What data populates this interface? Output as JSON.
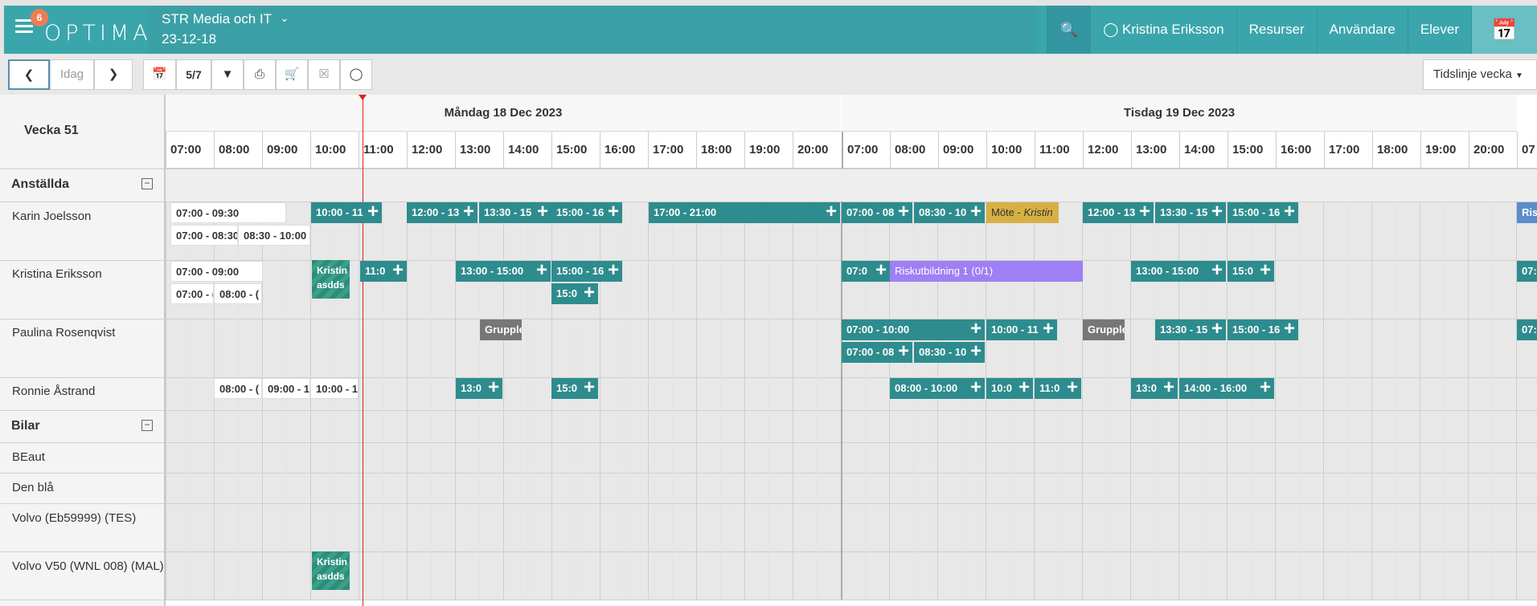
{
  "header": {
    "notifications": "6",
    "logo": "OPTIMA",
    "org_name": "STR Media och IT",
    "date": "23-12-18",
    "user": "Kristina Eriksson",
    "nav": [
      "Resurser",
      "Användare",
      "Elever"
    ]
  },
  "toolbar": {
    "today": "Idag",
    "days_count": "5/7",
    "view_select": "Tidslinje vecka"
  },
  "calendar": {
    "week": "Vecka 51",
    "days": [
      "Måndag 18 Dec 2023",
      "Tisdag 19 Dec 2023"
    ],
    "hours_day1": [
      "07:00",
      "08:00",
      "09:00",
      "10:00",
      "11:00",
      "12:00",
      "13:00",
      "14:00",
      "15:00",
      "16:00",
      "17:00",
      "18:00",
      "19:00",
      "20:00"
    ],
    "hours_day2": [
      "07:00",
      "08:00",
      "09:00",
      "10:00",
      "11:00",
      "12:00",
      "13:00",
      "14:00",
      "15:00",
      "16:00",
      "17:00",
      "18:00",
      "19:00",
      "20:00",
      "07"
    ],
    "sections": [
      "Anställda",
      "Bilar"
    ],
    "employees": [
      "Karin Joelsson",
      "Kristina Eriksson",
      "Paulina Rosenqvist",
      "Ronnie Åstrand"
    ],
    "cars": [
      "BEaut",
      "Den blå",
      "Volvo (Eb59999) (TES)",
      "Volvo V50 (WNL 008) (MAL)"
    ]
  },
  "events": {
    "karin": [
      "07:00 - 09:30",
      "07:00 - 08:30",
      "08:30 - 10:00",
      "10:00 - 11",
      "12:00 - 13",
      "13:30 - 15",
      "15:00 - 16",
      "17:00 - 21:00",
      "07:00 - 08",
      "08:30 - 10",
      "Möte -",
      "Kristin",
      "12:00 - 13",
      "13:30 - 15",
      "15:00 - 16",
      "Ris"
    ],
    "kristina": [
      "07:00 - 09:00",
      "07:00 - (",
      "08:00 - (",
      "Kristin",
      "asdds",
      "11:0",
      "13:00 - 15:00",
      "15:00 - 16",
      "15:0",
      "07:0",
      "Riskutbildning 1 (0/1)",
      "13:00 - 15:00",
      "15:0",
      "07:"
    ],
    "paulina": [
      "Grupple",
      "07:00 - 10:00",
      "10:00 - 11",
      "07:00 - 08",
      "08:30 - 10",
      "Grupple",
      "13:30 - 15",
      "15:00 - 16",
      "07:"
    ],
    "ronnie": [
      "08:00 - (",
      "09:00 - 1",
      "10:00 - 1",
      "13:0",
      "15:0",
      "08:00 - 10:00",
      "10:0",
      "11:0",
      "13:0",
      "14:00 - 16:00"
    ],
    "volvo_v50": [
      "Kristin",
      "asdds"
    ]
  },
  "colors": {
    "primary": "#3aa6ac",
    "event_teal": "#2e8c8e",
    "event_purple": "#9f7ff4",
    "event_gold": "#d7b045",
    "now_line": "#e02020"
  }
}
